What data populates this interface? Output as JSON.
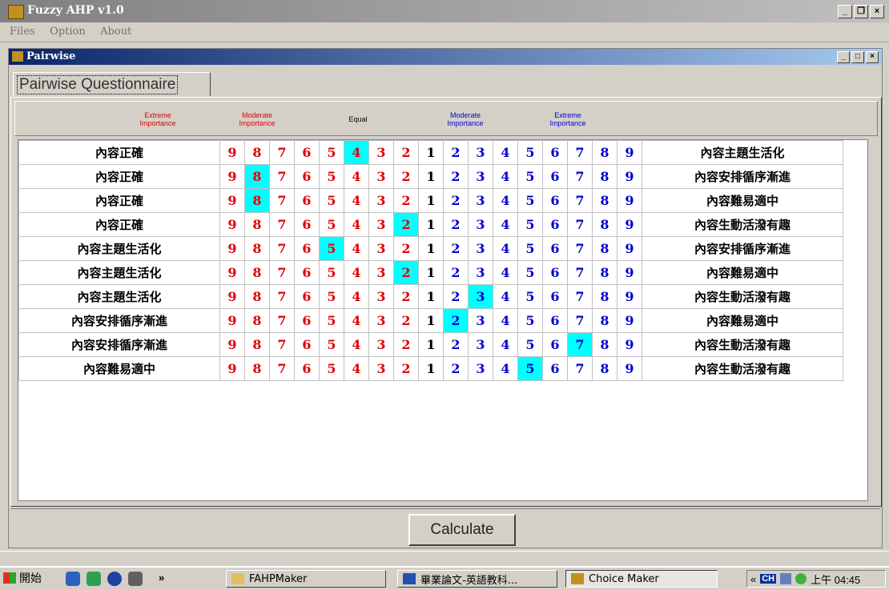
{
  "app": {
    "title": "Fuzzy AHP v1.0"
  },
  "menu": [
    "Files",
    "Option",
    "About"
  ],
  "child": {
    "title": "Pairwise",
    "tab_label": "Pairwise Questionnaire"
  },
  "header_labels": {
    "extreme_left": "Extreme\nImportance",
    "moderate_left": "Moderate\nImportance",
    "equal": "Equal",
    "moderate_right": "Moderate\nImportance",
    "extreme_right": "Extreme\nImportance"
  },
  "scale": [
    "9",
    "8",
    "7",
    "6",
    "5",
    "4",
    "3",
    "2",
    "1",
    "2",
    "3",
    "4",
    "5",
    "6",
    "7",
    "8",
    "9"
  ],
  "rows": [
    {
      "left": "內容正確",
      "right": "內容主題生活化",
      "selected": 5
    },
    {
      "left": "內容正確",
      "right": "內容安排循序漸進",
      "selected": 1
    },
    {
      "left": "內容正確",
      "right": "內容難易適中",
      "selected": 1
    },
    {
      "left": "內容正確",
      "right": "內容生動活潑有趣",
      "selected": 7
    },
    {
      "left": "內容主題生活化",
      "right": "內容安排循序漸進",
      "selected": 4
    },
    {
      "left": "內容主題生活化",
      "right": "內容難易適中",
      "selected": 7
    },
    {
      "left": "內容主題生活化",
      "right": "內容生動活潑有趣",
      "selected": 10
    },
    {
      "left": "內容安排循序漸進",
      "right": "內容難易適中",
      "selected": 9
    },
    {
      "left": "內容安排循序漸進",
      "right": "內容生動活潑有趣",
      "selected": 14
    },
    {
      "left": "內容難易適中",
      "right": "內容生動活潑有趣",
      "selected": 12
    }
  ],
  "calculate_label": "Calculate",
  "taskbar": {
    "start_label": "開始",
    "overflow": "»",
    "tasks": [
      "FAHPMaker",
      "畢業論文-英語教科...",
      "Choice Maker"
    ],
    "tray_lang": "CH",
    "tray_chevron": "«",
    "clock": "上午 04:45"
  },
  "colors": {
    "selected_cell": "#00ffff",
    "left_scale": "#e00000",
    "right_scale": "#0000d0"
  }
}
